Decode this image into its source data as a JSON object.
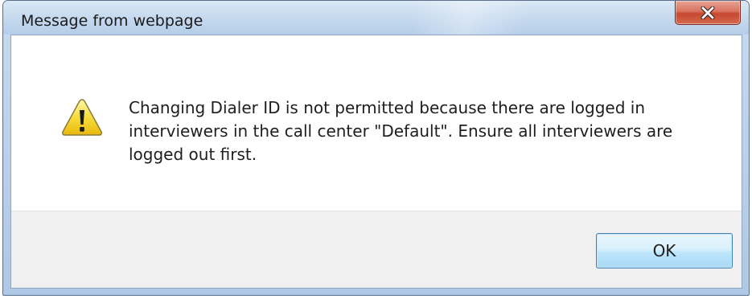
{
  "dialog": {
    "title": "Message from webpage",
    "close_icon": "close-icon",
    "icon": "warning-icon",
    "message_lines": [
      "Changing Dialer ID is not permitted because there are logged in",
      "interviewers in the call center \"Default\". Ensure all interviewers are",
      "logged out first."
    ],
    "ok_label": "OK"
  },
  "colors": {
    "close_button": "#c6472f",
    "ok_border": "#3c7fb1",
    "button_area_bg": "#f0f0f0",
    "titlebar": "#c6daef"
  }
}
